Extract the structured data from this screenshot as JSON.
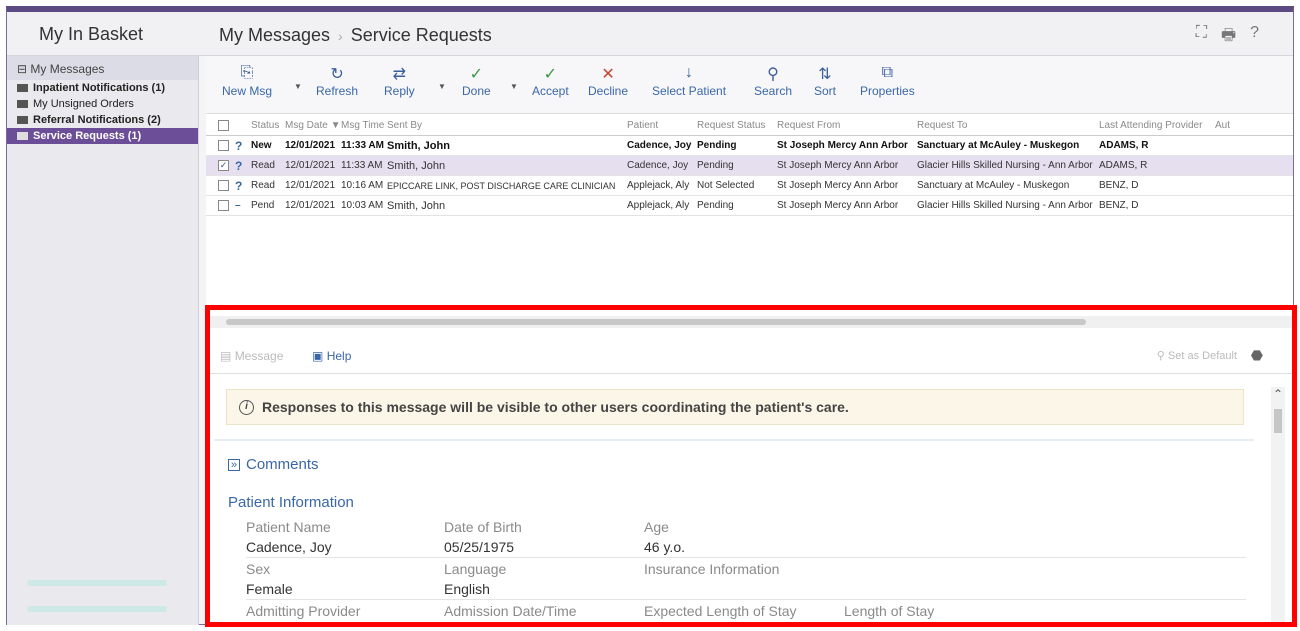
{
  "header": {
    "app_title": "My In Basket",
    "breadcrumb": [
      "My Messages",
      "Service Requests"
    ],
    "icons": [
      "expand-icon",
      "print-icon",
      "help-icon"
    ]
  },
  "sidebar": {
    "header": "My Messages",
    "items": [
      {
        "label": "Inpatient Notifications (1)",
        "bold": true
      },
      {
        "label": "My Unsigned Orders",
        "bold": false
      },
      {
        "label": "Referral Notifications (2)",
        "bold": true
      },
      {
        "label": "Service Requests (1)",
        "bold": true,
        "selected": true
      }
    ]
  },
  "toolbar": {
    "buttons": [
      {
        "label": "New Msg",
        "icon": "new-msg-icon"
      },
      {
        "label": "Refresh",
        "icon": "refresh-icon"
      },
      {
        "label": "Reply",
        "icon": "reply-icon"
      },
      {
        "label": "Done",
        "icon": "check-icon"
      },
      {
        "label": "Accept",
        "icon": "check-icon"
      },
      {
        "label": "Decline",
        "icon": "x-icon"
      },
      {
        "label": "Select Patient",
        "icon": "person-icon"
      },
      {
        "label": "Search",
        "icon": "search-icon"
      },
      {
        "label": "Sort",
        "icon": "sort-icon"
      },
      {
        "label": "Properties",
        "icon": "properties-icon"
      }
    ]
  },
  "grid": {
    "columns": [
      "Status",
      "Msg Date ▼",
      "Msg Time",
      "Sent By",
      "Patient",
      "Request Status",
      "Request From",
      "Request To",
      "Last Attending Provider",
      "Aut"
    ],
    "rows": [
      {
        "checked": false,
        "icon": "?",
        "status": "New",
        "date": "12/01/2021",
        "time": "11:33 AM",
        "sent_by": "Smith, John",
        "patient": "Cadence, Joy",
        "req_status": "Pending",
        "req_from": "St Joseph Mercy Ann Arbor",
        "req_to": "Sanctuary at McAuley - Muskegon",
        "provider": "ADAMS, R",
        "new": true
      },
      {
        "checked": true,
        "icon": "?",
        "status": "Read",
        "date": "12/01/2021",
        "time": "11:33 AM",
        "sent_by": "Smith, John",
        "patient": "Cadence, Joy",
        "req_status": "Pending",
        "req_from": "St Joseph Mercy Ann Arbor",
        "req_to": "Glacier Hills Skilled Nursing - Ann Arbor",
        "provider": "ADAMS, R",
        "selected": true
      },
      {
        "checked": false,
        "icon": "?",
        "status": "Read",
        "date": "12/01/2021",
        "time": "10:16 AM",
        "sent_by": "EPICCARE LINK, POST DISCHARGE CARE CLINICIAN",
        "patient": "Applejack, Aly",
        "req_status": "Not Selected",
        "req_from": "St Joseph Mercy Ann Arbor",
        "req_to": "Sanctuary at McAuley - Muskegon",
        "provider": "BENZ, D"
      },
      {
        "checked": false,
        "icon": "–",
        "status": "Pend",
        "date": "12/01/2021",
        "time": "10:03 AM",
        "sent_by": "Smith, John",
        "patient": "Applejack, Aly",
        "req_status": "Pending",
        "req_from": "St Joseph Mercy Ann Arbor",
        "req_to": "Glacier Hills Skilled Nursing - Ann Arbor",
        "provider": "BENZ, D"
      }
    ]
  },
  "detail": {
    "tab_message": "Message",
    "tab_help": "Help",
    "set_default": "Set as Default",
    "notice": "Responses to this message will be visible to other users coordinating the patient's care.",
    "comments": "Comments",
    "section_title": "Patient Information",
    "labels_row1": [
      "Patient Name",
      "Date of Birth",
      "Age"
    ],
    "values_row1": [
      "Cadence, Joy",
      "05/25/1975",
      "46 y.o."
    ],
    "labels_row2": [
      "Sex",
      "Language",
      "Insurance Information"
    ],
    "values_row2": [
      "Female",
      "English"
    ],
    "labels_row3": [
      "Admitting Provider",
      "Admission Date/Time",
      "Expected Length of Stay",
      "Length of Stay"
    ]
  },
  "colors": {
    "accent": "#6b4e97",
    "link": "#3a67a8",
    "highlight_box": "#ff0000"
  }
}
